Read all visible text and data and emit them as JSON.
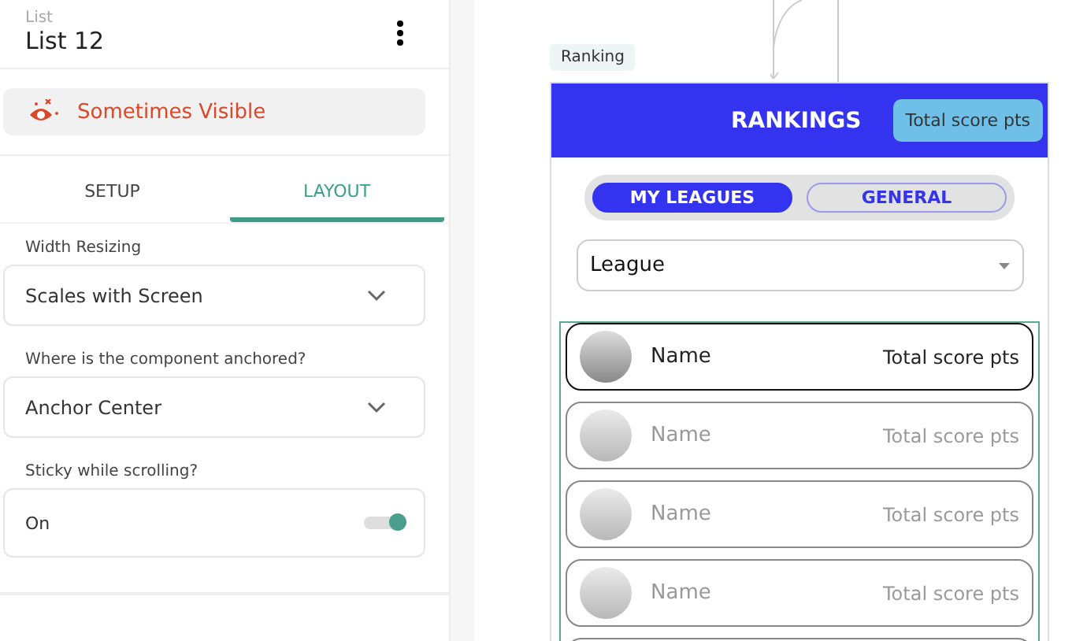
{
  "header": {
    "caption": "List",
    "title": "List 12"
  },
  "visibility": {
    "label": "Sometimes Visible"
  },
  "tabs": [
    {
      "label": "SETUP",
      "selected": false
    },
    {
      "label": "LAYOUT",
      "selected": true
    }
  ],
  "fields": [
    {
      "kind": "select",
      "label": "Width Resizing",
      "value": "Scales with Screen"
    },
    {
      "kind": "select",
      "label": "Where is the component anchored?",
      "value": "Anchor Center"
    },
    {
      "kind": "toggle",
      "label": "Sticky while scrolling?",
      "value": "On",
      "on": true
    }
  ],
  "canvas": {
    "screen_label": "Ranking",
    "title": "RANKINGS",
    "score_badge": "Total score pts",
    "segments": [
      {
        "label": "MY LEAGUES",
        "selected": true
      },
      {
        "label": "GENERAL",
        "selected": false
      }
    ],
    "league_select": {
      "value": "League"
    },
    "rows": [
      {
        "name": "Name",
        "score": "Total score pts",
        "selected": true
      },
      {
        "name": "Name",
        "score": "Total score pts",
        "selected": false
      },
      {
        "name": "Name",
        "score": "Total score pts",
        "selected": false
      },
      {
        "name": "Name",
        "score": "Total score pts",
        "selected": false
      }
    ]
  }
}
